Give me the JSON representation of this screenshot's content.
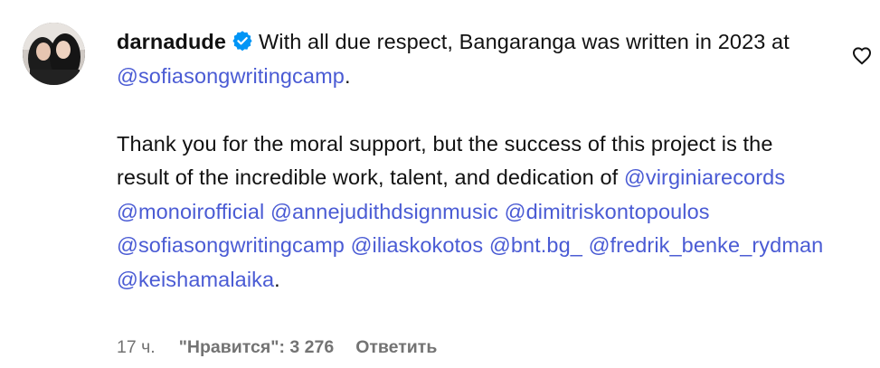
{
  "comment": {
    "author": {
      "username": "darnadude",
      "verified": true,
      "verified_icon": "verified-badge-icon",
      "avatar_icon": "avatar"
    },
    "line1_text": "With all due respect, Bangaranga was written in 2023 at",
    "line1_mention": "@sofiasongwritingcamp",
    "line1_end": ".",
    "para2_text": "Thank you for the moral support, but the success of this project is the result of the incredible work, talent, and dedication of",
    "mentions": [
      "@virginiarecords",
      "@monoirofficial",
      "@annejudithdsignmusic",
      "@dimitriskontopoulos",
      "@sofiasongwritingcamp",
      "@iliaskokotos",
      "@bnt.bg_",
      "@fredrik_benke_rydman",
      "@keishamalaika"
    ],
    "para2_end": ".",
    "like_icon": "heart-icon",
    "accent_color": "#4a5bd4"
  },
  "meta": {
    "time": "17 ч.",
    "likes": "\"Нравится\": 3 276",
    "reply": "Ответить"
  }
}
